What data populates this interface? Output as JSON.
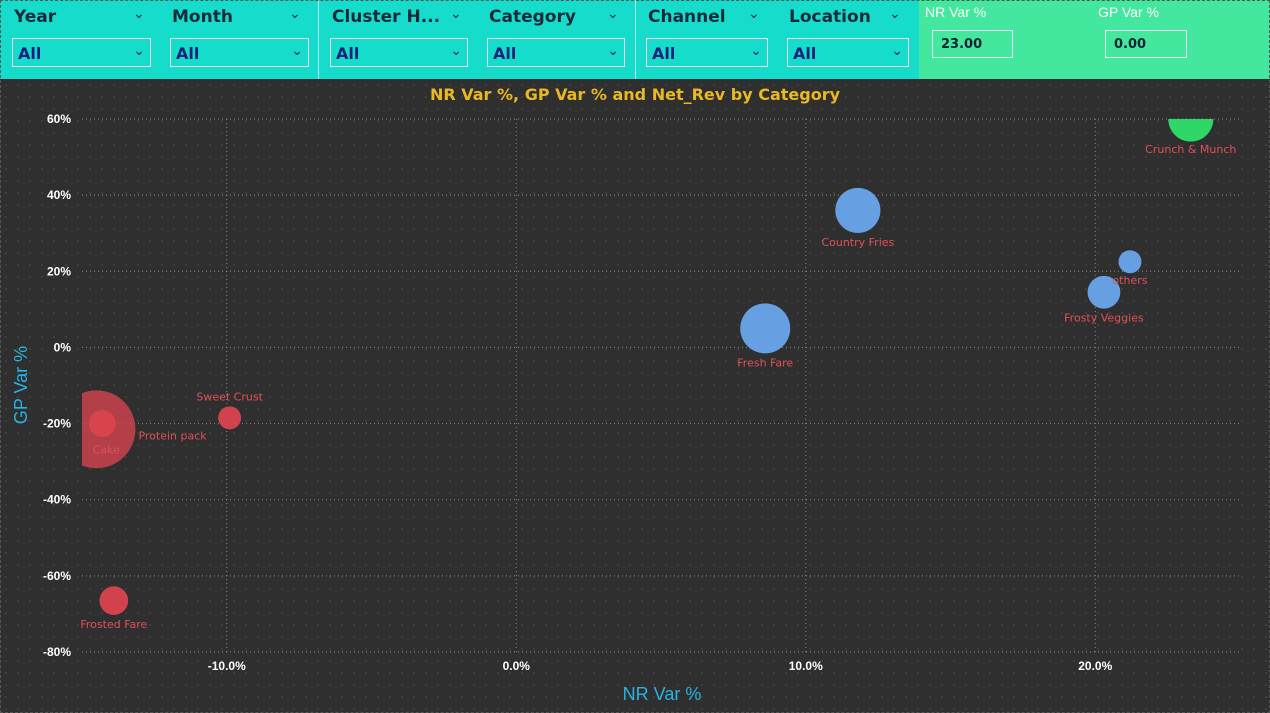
{
  "slicers": [
    {
      "title": "Year",
      "value": "All"
    },
    {
      "title": "Month",
      "value": "All"
    },
    {
      "title": "Cluster H...",
      "value": "All"
    },
    {
      "title": "Category",
      "value": "All"
    },
    {
      "title": "Channel",
      "value": "All"
    },
    {
      "title": "Location",
      "value": "All"
    }
  ],
  "kpis": {
    "nr_label": "NR Var %",
    "nr_value": "23.00",
    "gp_label": "GP Var %",
    "gp_value": "0.00"
  },
  "icons": {
    "chevron": "chevron-down-icon"
  },
  "colors": {
    "filter_bg": "#16dccb",
    "kpi_bg": "#44e79e",
    "chart_bg": "#2f2f2f",
    "title": "#e8b923",
    "axis_title": "#28b4e4",
    "negative": "#d9444f",
    "positive_blue": "#6aa6ec",
    "highlight_green": "#2ee06a",
    "point_label": "#e0505a"
  },
  "chart_data": {
    "type": "scatter",
    "title": "NR Var %, GP Var % and Net_Rev by Category",
    "xlabel": "NR Var %",
    "ylabel": "GP Var %",
    "xlim": [
      -15,
      25
    ],
    "ylim": [
      -80,
      60
    ],
    "xticks": [
      -10,
      0,
      10,
      20
    ],
    "xtick_labels": [
      "-10.0%",
      "0.0%",
      "10.0%",
      "20.0%"
    ],
    "yticks": [
      60,
      40,
      20,
      0,
      -20,
      -40,
      -60,
      -80
    ],
    "ytick_labels": [
      "60%",
      "40%",
      "20%",
      "0%",
      "-20%",
      "-40%",
      "-60%",
      "-80%"
    ],
    "grid": true,
    "points": [
      {
        "label": "Crunch & Munch",
        "x": 23.3,
        "y": 60,
        "size": 5.5,
        "group": "green"
      },
      {
        "label": "Country Fries",
        "x": 11.8,
        "y": 36,
        "size": 5.5,
        "group": "blue"
      },
      {
        "label": "others",
        "x": 21.2,
        "y": 22.5,
        "size": 2.8,
        "group": "blue"
      },
      {
        "label": "Frosty Veggies",
        "x": 20.3,
        "y": 14.5,
        "size": 4,
        "group": "blue"
      },
      {
        "label": "Fresh Fare",
        "x": 8.6,
        "y": 5,
        "size": 6.1,
        "group": "blue"
      },
      {
        "label": "Sweet Crust",
        "x": -9.9,
        "y": -18.5,
        "size": 2.8,
        "group": "red"
      },
      {
        "label": "Protein pack",
        "x": -14.5,
        "y": -21.5,
        "size": 9.5,
        "group": "red_faint"
      },
      {
        "label": "Cake",
        "x": -14.3,
        "y": -20,
        "size": 3.3,
        "group": "red"
      },
      {
        "label": "Frosted Fare",
        "x": -13.9,
        "y": -66.5,
        "size": 3.5,
        "group": "red"
      }
    ]
  }
}
